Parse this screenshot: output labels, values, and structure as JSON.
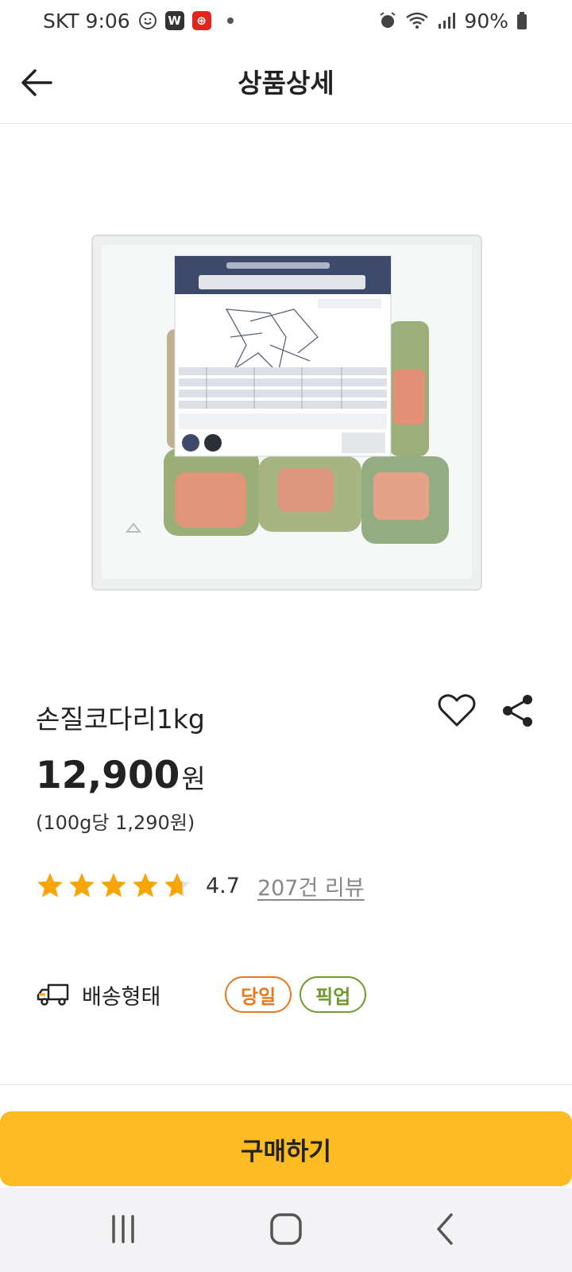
{
  "status": {
    "carrier_time": "SKT 9:06",
    "battery": "90%"
  },
  "header": {
    "title": "상품상세"
  },
  "product": {
    "name": "손질코다리1kg",
    "price": "12,900",
    "price_unit": "원",
    "unit_price": "(100g당 1,290원)",
    "rating": 4.7,
    "rating_text": "4.7",
    "review_link": "207건 리뷰"
  },
  "delivery": {
    "label": "배송형태",
    "chips": [
      {
        "label": "당일",
        "color": "#e8781e"
      },
      {
        "label": "픽업",
        "color": "#6e9a2e"
      }
    ]
  },
  "buy": {
    "label": "구매하기"
  },
  "colors": {
    "accent": "#fbbb21",
    "star": "#f6a609"
  },
  "icons": [
    "back-arrow-icon",
    "heart-icon",
    "share-icon",
    "star-icon",
    "truck-icon"
  ]
}
